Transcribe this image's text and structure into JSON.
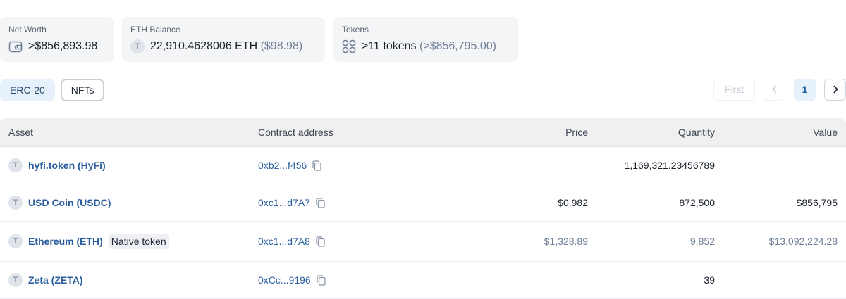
{
  "summary": {
    "net_worth": {
      "label": "Net Worth",
      "value": ">$856,893.98",
      "icon": "wallet-icon"
    },
    "eth_balance": {
      "label": "ETH Balance",
      "value": "22,910.4628006 ETH",
      "sub": "($98.98)",
      "icon_letter": "T"
    },
    "tokens": {
      "label": "Tokens",
      "value": ">11 tokens",
      "sub": "(>$856,795.00)",
      "icon": "tokens-grid-icon"
    }
  },
  "tabs": [
    {
      "label": "ERC-20",
      "active": true
    },
    {
      "label": "NFTs",
      "active": false
    }
  ],
  "pagination": {
    "first": "First",
    "prev": "‹",
    "current": "1",
    "next": "›"
  },
  "table": {
    "headers": {
      "asset": "Asset",
      "contract": "Contract address",
      "price": "Price",
      "quantity": "Quantity",
      "value": "Value"
    },
    "rows": [
      {
        "icon_letter": "T",
        "name": "hyfi.token (HyFi)",
        "badge": "",
        "address": "0xb2...f456",
        "price": "",
        "quantity": "1,169,321.23456789",
        "value": ""
      },
      {
        "icon_letter": "T",
        "name": "USD Coin (USDC)",
        "badge": "",
        "address": "0xc1...d7A7",
        "price": "$0.982",
        "quantity": "872,500",
        "value": "$856,795"
      },
      {
        "icon_letter": "T",
        "name": "Ethereum (ETH)",
        "badge": "Native token",
        "address": "0xc1...d7A8",
        "price": "$1,328.89",
        "quantity": "9,852",
        "value": "$13,092,224.28"
      },
      {
        "icon_letter": "T",
        "name": "Zeta (ZETA)",
        "badge": "",
        "address": "0xCc...9196",
        "price": "",
        "quantity": "39",
        "value": ""
      }
    ]
  },
  "colors": {
    "link": "#2a5e9e",
    "muted": "#6e7f96",
    "card_bg": "#f4f5f7",
    "active_tab_bg": "#e6f1fb"
  }
}
